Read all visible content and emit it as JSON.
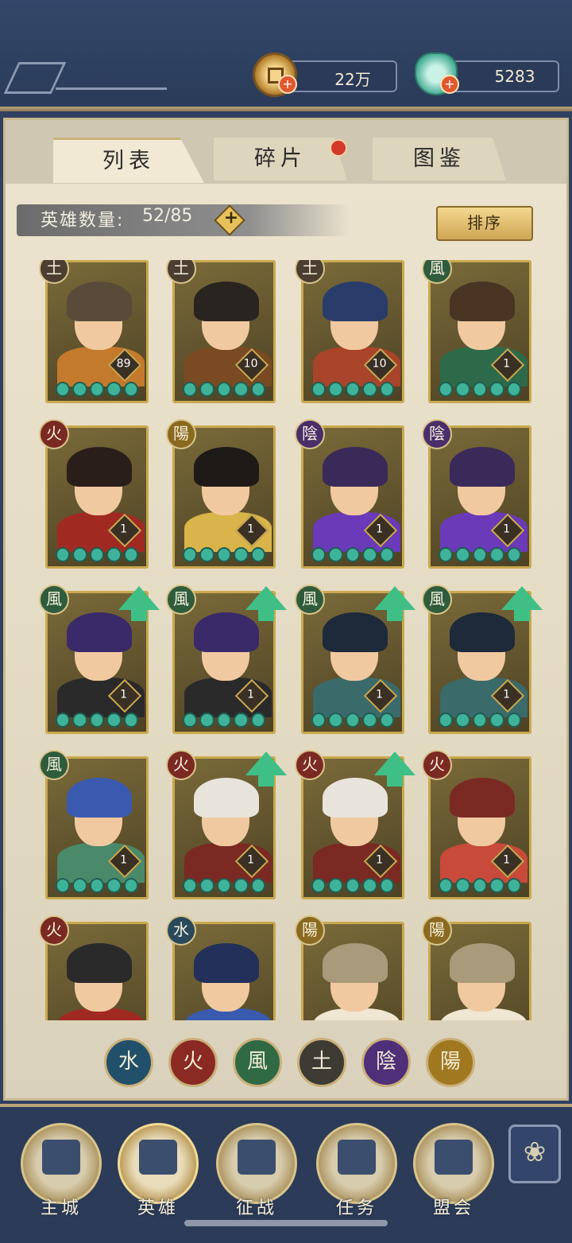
{
  "resources": {
    "coins": "22万",
    "jade": "5283"
  },
  "tabs": [
    {
      "label": "列表",
      "active": true
    },
    {
      "label": "碎片",
      "active": false,
      "notification": true
    },
    {
      "label": "图鉴",
      "active": false
    }
  ],
  "hero_count": {
    "label": "英雄数量:",
    "value": "52/85"
  },
  "sort_label": "排序",
  "heroes": [
    {
      "element": "土",
      "level": "89",
      "stars": 5,
      "upgrade": false,
      "hair": "#5a4a3a",
      "outfit": "#c47a2c"
    },
    {
      "element": "土",
      "level": "10",
      "stars": 5,
      "upgrade": false,
      "hair": "#2a2420",
      "outfit": "#7a4a22"
    },
    {
      "element": "土",
      "level": "10",
      "stars": 5,
      "upgrade": false,
      "hair": "#2a3d6a",
      "outfit": "#a8442a"
    },
    {
      "element": "風",
      "level": "1",
      "stars": 5,
      "upgrade": false,
      "hair": "#4a3424",
      "outfit": "#2d6a4a"
    },
    {
      "element": "火",
      "level": "1",
      "stars": 5,
      "upgrade": false,
      "hair": "#2a1e1a",
      "outfit": "#a02a22"
    },
    {
      "element": "陽",
      "level": "1",
      "stars": 5,
      "upgrade": false,
      "hair": "#1e1a18",
      "outfit": "#d8b44a"
    },
    {
      "element": "陰",
      "level": "1",
      "stars": 5,
      "upgrade": false,
      "hair": "#3a2a5a",
      "outfit": "#6a3ab8"
    },
    {
      "element": "陰",
      "level": "1",
      "stars": 5,
      "upgrade": false,
      "hair": "#3a2a5a",
      "outfit": "#6a3ab8"
    },
    {
      "element": "風",
      "level": "1",
      "stars": 5,
      "upgrade": true,
      "hair": "#3a2a6a",
      "outfit": "#2a2a2a"
    },
    {
      "element": "風",
      "level": "1",
      "stars": 5,
      "upgrade": true,
      "hair": "#3a2a6a",
      "outfit": "#2a2a2a"
    },
    {
      "element": "風",
      "level": "1",
      "stars": 5,
      "upgrade": true,
      "hair": "#1e2a3a",
      "outfit": "#3a6a6a"
    },
    {
      "element": "風",
      "level": "1",
      "stars": 5,
      "upgrade": true,
      "hair": "#1e2a3a",
      "outfit": "#3a6a6a"
    },
    {
      "element": "風",
      "level": "1",
      "stars": 5,
      "upgrade": false,
      "hair": "#3a5ab0",
      "outfit": "#4a8a6a"
    },
    {
      "element": "火",
      "level": "1",
      "stars": 5,
      "upgrade": true,
      "hair": "#e8e4dc",
      "outfit": "#7a2a22"
    },
    {
      "element": "火",
      "level": "1",
      "stars": 5,
      "upgrade": true,
      "hair": "#e8e4dc",
      "outfit": "#7a2a22"
    },
    {
      "element": "火",
      "level": "1",
      "stars": 5,
      "upgrade": false,
      "hair": "#7a2a22",
      "outfit": "#c84a3a"
    },
    {
      "element": "火",
      "level": "",
      "stars": 0,
      "upgrade": false,
      "hair": "#2a2a2a",
      "outfit": "#a02a22"
    },
    {
      "element": "水",
      "level": "",
      "stars": 0,
      "upgrade": false,
      "hair": "#22305a",
      "outfit": "#3a5ab0"
    },
    {
      "element": "陽",
      "level": "",
      "stars": 0,
      "upgrade": false,
      "hair": "#a89a7a",
      "outfit": "#efe7d2"
    },
    {
      "element": "陽",
      "level": "",
      "stars": 0,
      "upgrade": false,
      "hair": "#a89a7a",
      "outfit": "#efe7d2"
    }
  ],
  "element_filters": [
    "水",
    "火",
    "風",
    "土",
    "陰",
    "陽"
  ],
  "nav": [
    {
      "label": "主城"
    },
    {
      "label": "英雄",
      "active": true
    },
    {
      "label": "征战"
    },
    {
      "label": "任务"
    },
    {
      "label": "盟会"
    }
  ],
  "menu_icon": "flower-menu-icon"
}
